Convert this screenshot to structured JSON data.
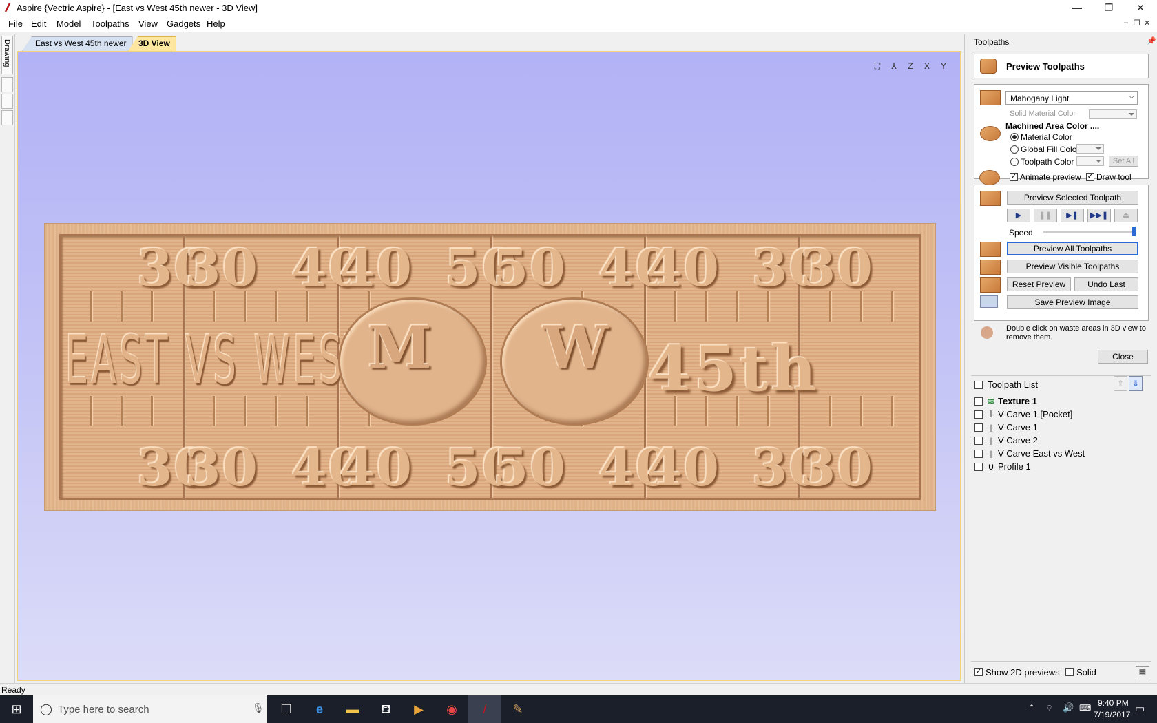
{
  "window": {
    "title": "Aspire {Vectric Aspire} - [East vs West 45th newer - 3D View]",
    "minimize": "—",
    "restore": "❐",
    "close": "✕"
  },
  "menu": [
    "File",
    "Edit",
    "Model",
    "Toolpaths",
    "View",
    "Gadgets",
    "Help"
  ],
  "left_tabs": {
    "drawing": "Drawing"
  },
  "doc_tabs": [
    {
      "label": "East vs West 45th newer"
    },
    {
      "label": "3D View"
    }
  ],
  "view_icons": [
    "fit-view-icon",
    "iso-view-icon",
    "z-view-icon",
    "x-view-icon",
    "y-view-icon"
  ],
  "view_icon_glyphs": [
    "⛶",
    "⅄",
    "Z",
    "X",
    "Y"
  ],
  "board": {
    "yard_top": [
      "30",
      "30",
      "40",
      "40",
      "50",
      "50",
      "40",
      "40",
      "30",
      "30"
    ],
    "yard_bottom": [
      "30",
      "30",
      "40",
      "40",
      "50",
      "50",
      "40",
      "40",
      "30",
      "30"
    ],
    "text_left": "EAST VS",
    "text_right": "VS WEST",
    "helmet_left": "M",
    "helmet_right": "W",
    "grade": "45th"
  },
  "panel": {
    "title": "Toolpaths",
    "preview_title": "Preview Toolpaths",
    "material": "Mahogany Light",
    "solid_material_color": "Solid Material Color",
    "machined_area": "Machined Area Color ....",
    "opt_material": "Material Color",
    "opt_global": "Global Fill Color",
    "opt_toolpath": "Toolpath Color",
    "set_all": "Set All",
    "animate": "Animate preview",
    "draw_tool": "Draw tool",
    "preview_selected": "Preview Selected Toolpath",
    "speed": "Speed",
    "speed_value": 1.0,
    "preview_all": "Preview All Toolpaths",
    "preview_visible": "Preview Visible Toolpaths",
    "reset": "Reset Preview",
    "undo": "Undo Last",
    "save_image": "Save Preview Image",
    "hint": "Double click on waste areas in 3D view to remove them.",
    "close": "Close",
    "list_title": "Toolpath List",
    "items": [
      {
        "label": "Texture 1",
        "icon": "≋"
      },
      {
        "label": "V-Carve 1 [Pocket]",
        "icon": "⫴"
      },
      {
        "label": "V-Carve 1",
        "icon": "⫵"
      },
      {
        "label": "V-Carve 2",
        "icon": "⫵"
      },
      {
        "label": "V-Carve East vs West",
        "icon": "⫵"
      },
      {
        "label": "Profile 1",
        "icon": "∪"
      }
    ],
    "show_2d": "Show 2D previews",
    "solid": "Solid"
  },
  "status": {
    "text": "Ready"
  },
  "taskbar": {
    "search": "Type here to search",
    "time": "9:40 PM",
    "date": "7/19/2017"
  },
  "colors": {
    "accent": "#2a6ad6",
    "view_top": "#b2b2f6",
    "wood": "#e2b48b"
  }
}
